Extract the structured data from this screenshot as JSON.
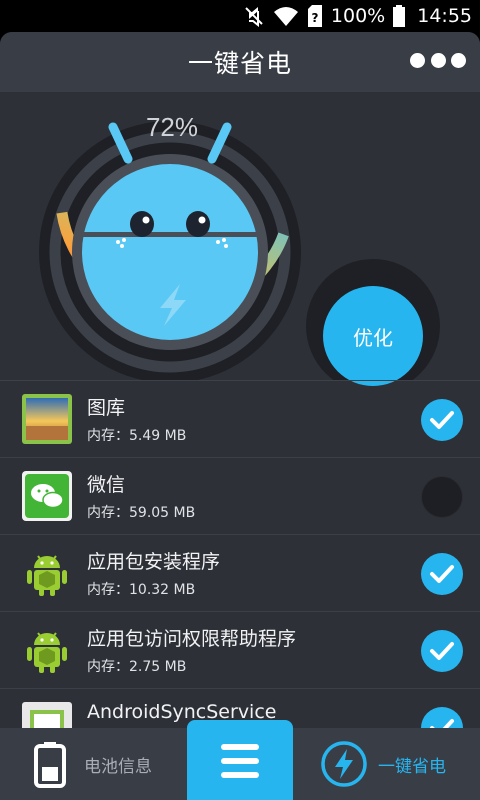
{
  "status_bar": {
    "battery_text": "100%",
    "time": "14:55",
    "icons": [
      "mute-icon",
      "wifi-icon",
      "sim-icon",
      "battery-icon"
    ]
  },
  "header": {
    "title": "一键省电",
    "more_icon": "more-dots-icon"
  },
  "battery_gauge": {
    "percent_text": "72%",
    "level": 0.72
  },
  "optimize_button": {
    "label": "优化"
  },
  "apps": [
    {
      "name": "图库",
      "memory": "内存：5.49 MB",
      "checked": true,
      "icon": "gallery-icon"
    },
    {
      "name": "微信",
      "memory": "内存：59.05 MB",
      "checked": false,
      "icon": "wechat-icon"
    },
    {
      "name": "应用包安装程序",
      "memory": "内存：10.32 MB",
      "checked": true,
      "icon": "android-icon"
    },
    {
      "name": "应用包访问权限帮助程序",
      "memory": "内存：2.75 MB",
      "checked": true,
      "icon": "android-icon"
    },
    {
      "name": "AndroidSyncService",
      "memory": "",
      "checked": true,
      "icon": "app-icon"
    }
  ],
  "bottom_nav": {
    "battery_info_label": "电池信息",
    "menu_icon": "menu-icon",
    "one_click_save_label": "一键省电"
  },
  "colors": {
    "accent": "#27b5ef",
    "background": "#2d3037",
    "header": "#393d46"
  }
}
